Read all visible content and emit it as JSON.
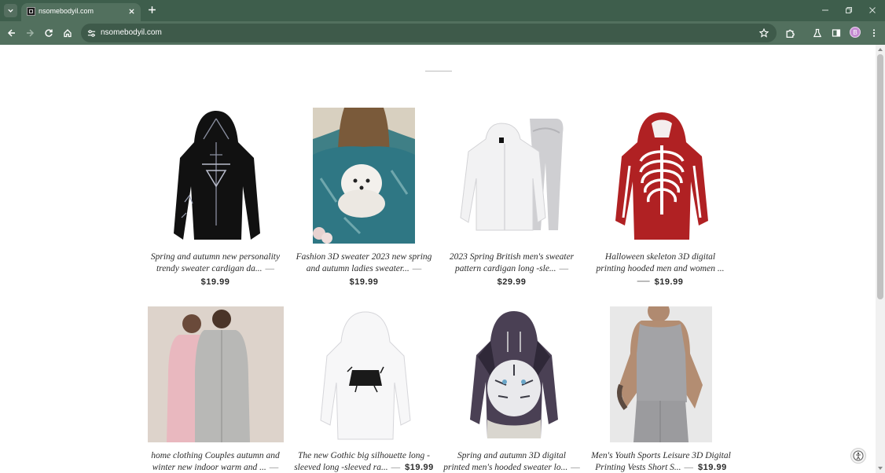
{
  "browser": {
    "tab_title": "nsomebodyil.com",
    "url": "nsomebodyil.com",
    "profile_initial": "B"
  },
  "products": [
    {
      "title_line1": "Spring and autumn new personality",
      "title_line2": "trendy sweater cardigan da...",
      "dash": "—",
      "price": "$19.99",
      "image": "black-zip-hoodie-gothic-print"
    },
    {
      "title_line1": "Fashion 3D sweater 2023 new spring",
      "title_line2": "and autumn ladies sweater...",
      "dash": "—",
      "price": "$19.99",
      "image": "teal-sweater-white-dog-print"
    },
    {
      "title_line1": "2023 Spring British men's sweater",
      "title_line2": "pattern cardigan long -sle...",
      "dash": "—",
      "price": "$29.99",
      "image": "white-hoodie-grey-pants-set"
    },
    {
      "title_line1": "Halloween skeleton 3D digital",
      "title_line2": "printing hooded men and women ...",
      "dash": "—",
      "price": "$19.99",
      "image": "red-skeleton-hoodie"
    },
    {
      "title_line1": "home clothing Couples autumn and",
      "title_line2": "winter new indoor warm and ...",
      "dash": "—",
      "price": "",
      "image": "couple-fleece-pajamas"
    },
    {
      "title_line1": "The new Gothic big silhouette long -",
      "title_line2": "sleeved long -sleeved ra...",
      "dash": "—",
      "price": "$19.99",
      "image": "white-gothic-hoodie"
    },
    {
      "title_line1": "Spring and autumn 3D digital",
      "title_line2": "printed men's hooded sweater lo...",
      "dash": "—",
      "price": "",
      "image": "white-tiger-3d-hoodie"
    },
    {
      "title_line1": "Men's Youth Sports Leisure 3D Digital",
      "title_line2": "Printing Vests Short S...",
      "dash": "—",
      "price": "$19.99",
      "image": "grey-tank-top-shorts"
    }
  ]
}
